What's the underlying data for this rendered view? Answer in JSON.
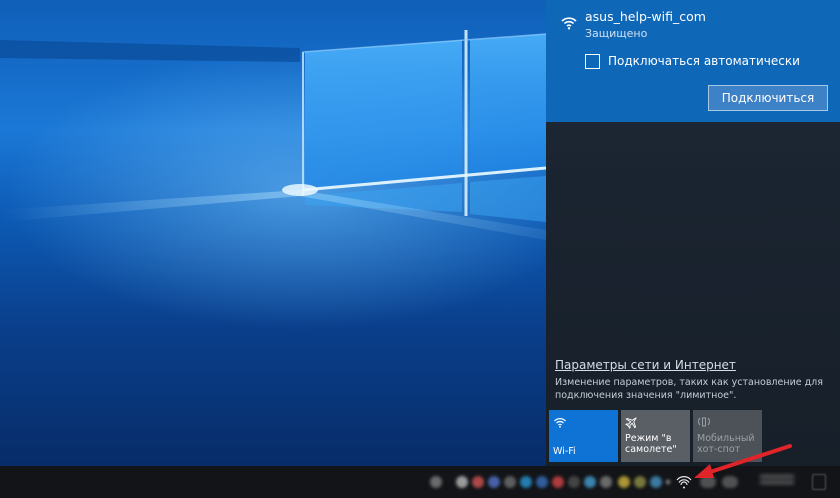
{
  "network": {
    "name": "asus_help-wifi_com",
    "status": "Защищено",
    "auto_connect_label": "Подключаться автоматически",
    "auto_connect_checked": false,
    "connect_button": "Подключиться"
  },
  "settings": {
    "link": "Параметры сети и Интернет",
    "description": "Изменение параметров, таких как установление для подключения значения \"лимитное\"."
  },
  "quick_actions": [
    {
      "label": "Wi-Fi",
      "icon": "wifi-icon",
      "active": true
    },
    {
      "label": "Режим \"в самолете\"",
      "icon": "airplane-icon",
      "active": false
    },
    {
      "label": "Мобильный хот-спот",
      "icon": "hotspot-icon",
      "active": false,
      "disabled": true
    }
  ],
  "colors": {
    "accent": "#0f67b8",
    "tile_active": "#0f73d6",
    "flyout_bg": "#1a2430",
    "taskbar": "#121417",
    "annotation_arrow": "#e0242a"
  }
}
